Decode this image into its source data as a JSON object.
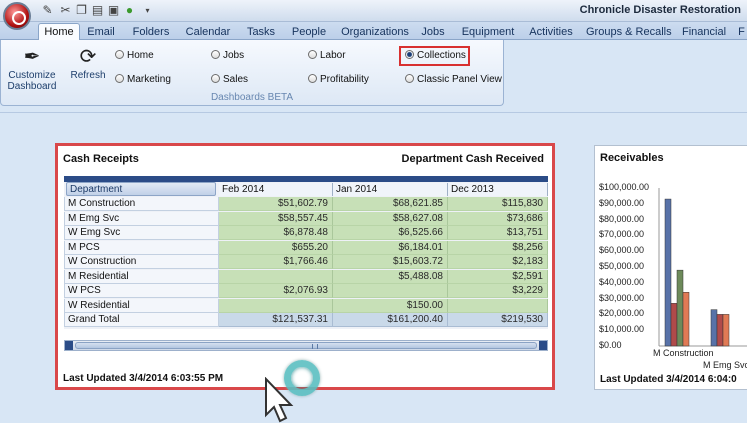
{
  "window": {
    "title": "Chronicle Disaster Restoration"
  },
  "quick_access": [
    "pencil-icon",
    "cut-icon",
    "copy-icon",
    "paste-icon",
    "camera-icon",
    "refresh-circle-icon",
    "dropdown-icon"
  ],
  "tabs": [
    "Home",
    "Email",
    "Folders",
    "Calendar",
    "Tasks",
    "People",
    "Organizations",
    "Jobs",
    "Equipment",
    "Activities",
    "Groups & Recalls",
    "Financial",
    "F"
  ],
  "active_tab": "Home",
  "ribbon": {
    "customize_label": "Customize Dashboard",
    "refresh_label": "Refresh",
    "group_label": "Dashboards BETA",
    "radios": {
      "home": "Home",
      "marketing": "Marketing",
      "jobs": "Jobs",
      "sales": "Sales",
      "labor": "Labor",
      "profitability": "Profitability",
      "collections": "Collections",
      "classic": "Classic Panel View"
    },
    "selected_radio": "Collections"
  },
  "cash_receipts": {
    "title": "Cash Receipts",
    "subtitle": "Department Cash Received",
    "dept_header": "Department",
    "columns": [
      "Feb 2014",
      "Jan 2014",
      "Dec 2013"
    ],
    "rows": [
      {
        "label": "M Construction",
        "values": [
          "$51,602.79",
          "$68,621.85",
          "$115,830"
        ]
      },
      {
        "label": "M Emg Svc",
        "values": [
          "$58,557.45",
          "$58,627.08",
          "$73,686"
        ]
      },
      {
        "label": "W Emg Svc",
        "values": [
          "$6,878.48",
          "$6,525.66",
          "$13,751"
        ]
      },
      {
        "label": "M PCS",
        "values": [
          "$655.20",
          "$6,184.01",
          "$8,256"
        ]
      },
      {
        "label": "W Construction",
        "values": [
          "$1,766.46",
          "$15,603.72",
          "$2,183"
        ]
      },
      {
        "label": "M Residential",
        "values": [
          "",
          "$5,488.08",
          "$2,591"
        ]
      },
      {
        "label": "W PCS",
        "values": [
          "$2,076.93",
          "",
          "$3,229"
        ]
      },
      {
        "label": "W Residential",
        "values": [
          "",
          "$150.00",
          ""
        ]
      }
    ],
    "total": {
      "label": "Grand Total",
      "values": [
        "$121,537.31",
        "$161,200.40",
        "$219,530"
      ]
    },
    "updated": "Last Updated 3/4/2014 6:03:55 PM"
  },
  "receivables": {
    "title": "Receivables",
    "y_ticks": [
      "$100,000.00",
      "$90,000.00",
      "$80,000.00",
      "$70,000.00",
      "$60,000.00",
      "$50,000.00",
      "$40,000.00",
      "$30,000.00",
      "$20,000.00",
      "$10,000.00",
      "$0.00"
    ],
    "categories": [
      "M Construction",
      "M Emg Svc"
    ],
    "updated": "Last Updated 3/4/2014 6:04:0"
  },
  "chart_data": {
    "type": "bar",
    "title": "Receivables",
    "categories": [
      "M Construction",
      "M Emg Svc"
    ],
    "series": [
      {
        "values": [
          93000,
          23000
        ],
        "color": "#5872a8"
      },
      {
        "values": [
          27000,
          20000
        ],
        "color": "#b04a4a"
      },
      {
        "values": [
          48000,
          0
        ],
        "color": "#6d8a5a"
      },
      {
        "values": [
          34000,
          0
        ],
        "color": "#e07a55"
      },
      {
        "values": [
          0,
          20000
        ],
        "color": "#e07a55"
      }
    ],
    "ylim": [
      0,
      100000
    ]
  }
}
